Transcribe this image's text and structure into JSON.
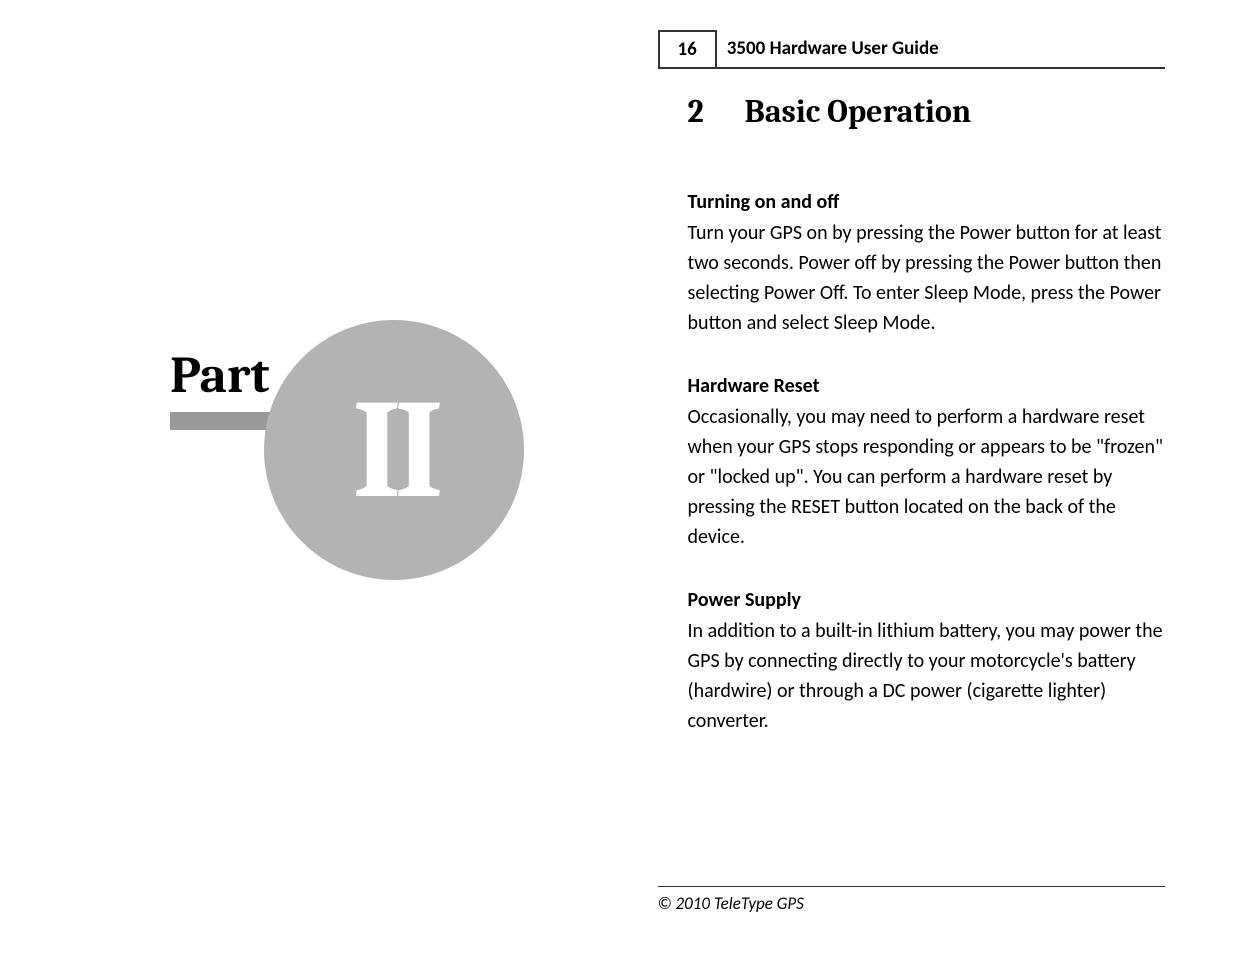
{
  "left": {
    "part_label": "Part",
    "roman": "II"
  },
  "header": {
    "page_number": "16",
    "title": "3500 Hardware User Guide"
  },
  "chapter": {
    "number": "2",
    "title": "Basic Operation"
  },
  "sections": [
    {
      "title": "Turning on and off",
      "body": "Turn your GPS on by pressing the Power button for at least two seconds. Power off by pressing the Power button then selecting Power Off. To enter Sleep Mode, press the Power button and select Sleep Mode."
    },
    {
      "title": "Hardware Reset",
      "body": "Occasionally, you may need to perform a hardware reset when your GPS stops responding or appears to be \"frozen\" or \"locked up\". You can perform a hardware reset by pressing the RESET button located on the back of the device."
    },
    {
      "title": "Power Supply",
      "body": "In addition to a built-in lithium battery, you may power the GPS by connecting directly to your motorcycle's battery (hardwire) or through a DC power (cigarette lighter) converter."
    }
  ],
  "footer": {
    "copyright": "© 2010 TeleType GPS"
  }
}
